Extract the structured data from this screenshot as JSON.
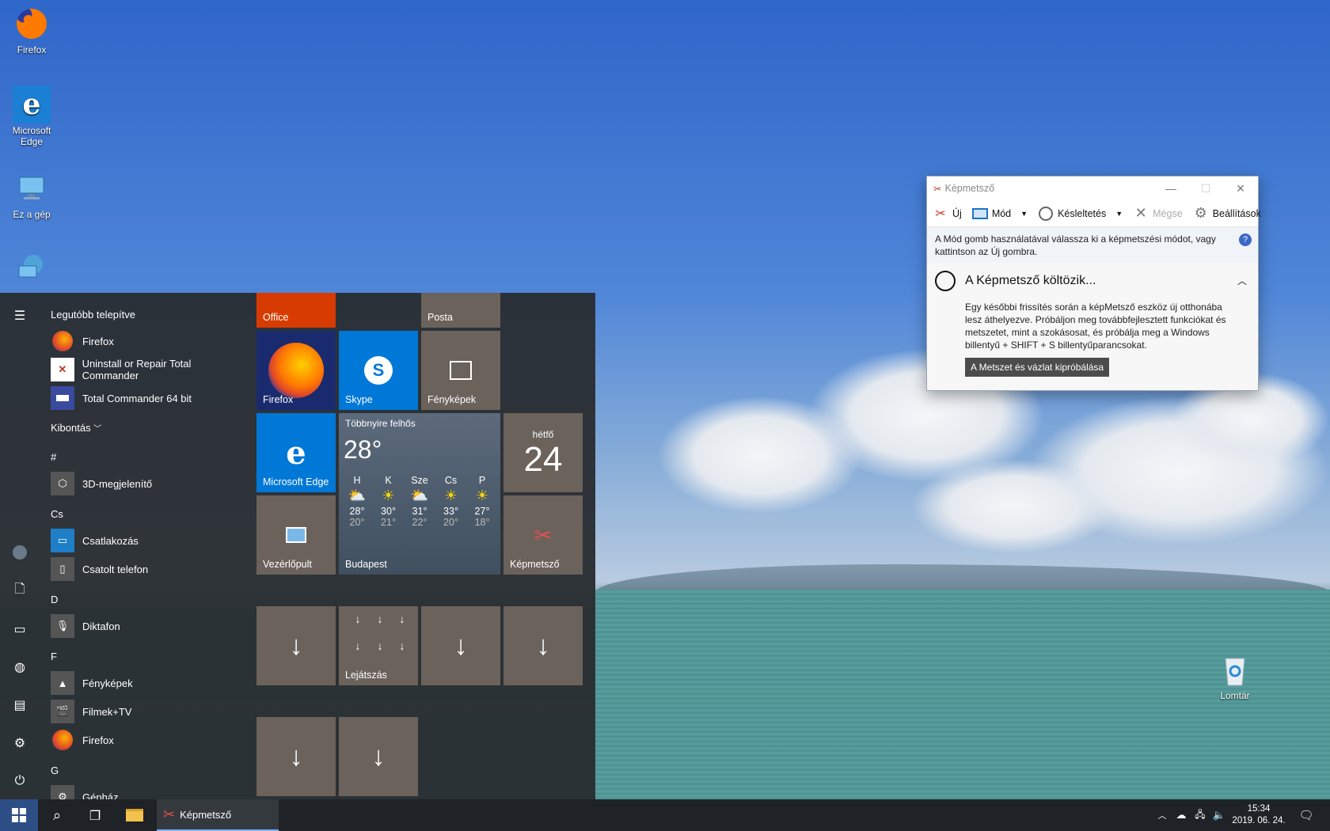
{
  "desktop": {
    "icons": [
      {
        "label": "Firefox",
        "icon": "firefox-icon"
      },
      {
        "label": "Microsoft Edge",
        "icon": "edge-icon"
      },
      {
        "label": "Ez a gép",
        "icon": "this-pc-icon"
      },
      {
        "label": "Lomtár",
        "icon": "recycle-bin-icon"
      }
    ]
  },
  "start": {
    "recent_header": "Legutóbb telepítve",
    "recent": [
      {
        "label": "Firefox",
        "icon": "firefox-icon"
      },
      {
        "label": "Uninstall or Repair Total Commander",
        "icon": "uninstall-icon"
      },
      {
        "label": "Total Commander 64 bit",
        "icon": "floppy-icon"
      }
    ],
    "expand": "Kibontás",
    "groups": [
      {
        "letter": "#",
        "apps": [
          {
            "label": "3D-megjelenítő",
            "icon": "cube-icon"
          }
        ]
      },
      {
        "letter": "Cs",
        "apps": [
          {
            "label": "Csatlakozás",
            "icon": "connect-icon"
          },
          {
            "label": "Csatolt telefon",
            "icon": "phone-icon"
          }
        ]
      },
      {
        "letter": "D",
        "apps": [
          {
            "label": "Diktafon",
            "icon": "microphone-icon"
          }
        ]
      },
      {
        "letter": "F",
        "apps": [
          {
            "label": "Fényképek",
            "icon": "photos-icon"
          },
          {
            "label": "Filmek+TV",
            "icon": "clapper-icon"
          },
          {
            "label": "Firefox",
            "icon": "firefox-icon"
          }
        ]
      },
      {
        "letter": "G",
        "apps": [
          {
            "label": "Gépház",
            "icon": "gear-icon"
          }
        ]
      }
    ],
    "tiles": {
      "office": "Office",
      "posta": "Posta",
      "firefox": "Firefox",
      "skype": "Skype",
      "photos": "Fényképek",
      "edge": "Microsoft Edge",
      "control_panel": "Vezérlőpult",
      "snipping": "Képmetsző",
      "play": "Lejátszás",
      "calendar_day": "hétfő",
      "calendar_date": "24"
    },
    "weather": {
      "condition": "Többnyire felhős",
      "temp": "28°",
      "city": "Budapest",
      "days": [
        {
          "day": "H",
          "high": "28°",
          "low": "20°",
          "icon": "partly-cloudy-icon"
        },
        {
          "day": "K",
          "high": "30°",
          "low": "21°",
          "icon": "sun-icon"
        },
        {
          "day": "Sze",
          "high": "31°",
          "low": "22°",
          "icon": "partly-cloudy-icon"
        },
        {
          "day": "Cs",
          "high": "33°",
          "low": "20°",
          "icon": "sun-icon"
        },
        {
          "day": "P",
          "high": "27°",
          "low": "18°",
          "icon": "sun-icon"
        }
      ]
    }
  },
  "snip": {
    "title": "Képmetsző",
    "toolbar": {
      "new": "Új",
      "mode": "Mód",
      "delay": "Késleltetés",
      "cancel": "Mégse",
      "settings": "Beállítások"
    },
    "info": "A Mód gomb használatával válassza ki a képmetszési módot, vagy kattintson az Új gombra.",
    "notice_title": "A Képmetsző költözik...",
    "notice_body": "Egy későbbi frissítés során a képMetsző eszköz új otthonába lesz áthelyezve. Próbáljon meg továbbfejlesztett funkciókat és metszetet, mint a szokásosat, és próbálja meg a Windows billentyű + SHIFT + S billentyűparancsokat.",
    "try_button": "A Metszet és vázlat kipróbálása"
  },
  "taskbar": {
    "app_label": "Képmetsző",
    "time": "15:34",
    "date": "2019. 06. 24."
  }
}
